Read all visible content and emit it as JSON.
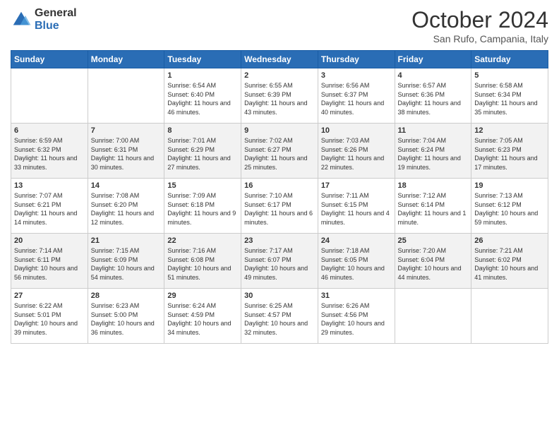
{
  "header": {
    "logo_general": "General",
    "logo_blue": "Blue",
    "title": "October 2024",
    "location": "San Rufo, Campania, Italy"
  },
  "weekdays": [
    "Sunday",
    "Monday",
    "Tuesday",
    "Wednesday",
    "Thursday",
    "Friday",
    "Saturday"
  ],
  "weeks": [
    [
      {
        "day": "",
        "sunrise": "",
        "sunset": "",
        "daylight": ""
      },
      {
        "day": "",
        "sunrise": "",
        "sunset": "",
        "daylight": ""
      },
      {
        "day": "1",
        "sunrise": "Sunrise: 6:54 AM",
        "sunset": "Sunset: 6:40 PM",
        "daylight": "Daylight: 11 hours and 46 minutes."
      },
      {
        "day": "2",
        "sunrise": "Sunrise: 6:55 AM",
        "sunset": "Sunset: 6:39 PM",
        "daylight": "Daylight: 11 hours and 43 minutes."
      },
      {
        "day": "3",
        "sunrise": "Sunrise: 6:56 AM",
        "sunset": "Sunset: 6:37 PM",
        "daylight": "Daylight: 11 hours and 40 minutes."
      },
      {
        "day": "4",
        "sunrise": "Sunrise: 6:57 AM",
        "sunset": "Sunset: 6:36 PM",
        "daylight": "Daylight: 11 hours and 38 minutes."
      },
      {
        "day": "5",
        "sunrise": "Sunrise: 6:58 AM",
        "sunset": "Sunset: 6:34 PM",
        "daylight": "Daylight: 11 hours and 35 minutes."
      }
    ],
    [
      {
        "day": "6",
        "sunrise": "Sunrise: 6:59 AM",
        "sunset": "Sunset: 6:32 PM",
        "daylight": "Daylight: 11 hours and 33 minutes."
      },
      {
        "day": "7",
        "sunrise": "Sunrise: 7:00 AM",
        "sunset": "Sunset: 6:31 PM",
        "daylight": "Daylight: 11 hours and 30 minutes."
      },
      {
        "day": "8",
        "sunrise": "Sunrise: 7:01 AM",
        "sunset": "Sunset: 6:29 PM",
        "daylight": "Daylight: 11 hours and 27 minutes."
      },
      {
        "day": "9",
        "sunrise": "Sunrise: 7:02 AM",
        "sunset": "Sunset: 6:27 PM",
        "daylight": "Daylight: 11 hours and 25 minutes."
      },
      {
        "day": "10",
        "sunrise": "Sunrise: 7:03 AM",
        "sunset": "Sunset: 6:26 PM",
        "daylight": "Daylight: 11 hours and 22 minutes."
      },
      {
        "day": "11",
        "sunrise": "Sunrise: 7:04 AM",
        "sunset": "Sunset: 6:24 PM",
        "daylight": "Daylight: 11 hours and 19 minutes."
      },
      {
        "day": "12",
        "sunrise": "Sunrise: 7:05 AM",
        "sunset": "Sunset: 6:23 PM",
        "daylight": "Daylight: 11 hours and 17 minutes."
      }
    ],
    [
      {
        "day": "13",
        "sunrise": "Sunrise: 7:07 AM",
        "sunset": "Sunset: 6:21 PM",
        "daylight": "Daylight: 11 hours and 14 minutes."
      },
      {
        "day": "14",
        "sunrise": "Sunrise: 7:08 AM",
        "sunset": "Sunset: 6:20 PM",
        "daylight": "Daylight: 11 hours and 12 minutes."
      },
      {
        "day": "15",
        "sunrise": "Sunrise: 7:09 AM",
        "sunset": "Sunset: 6:18 PM",
        "daylight": "Daylight: 11 hours and 9 minutes."
      },
      {
        "day": "16",
        "sunrise": "Sunrise: 7:10 AM",
        "sunset": "Sunset: 6:17 PM",
        "daylight": "Daylight: 11 hours and 6 minutes."
      },
      {
        "day": "17",
        "sunrise": "Sunrise: 7:11 AM",
        "sunset": "Sunset: 6:15 PM",
        "daylight": "Daylight: 11 hours and 4 minutes."
      },
      {
        "day": "18",
        "sunrise": "Sunrise: 7:12 AM",
        "sunset": "Sunset: 6:14 PM",
        "daylight": "Daylight: 11 hours and 1 minute."
      },
      {
        "day": "19",
        "sunrise": "Sunrise: 7:13 AM",
        "sunset": "Sunset: 6:12 PM",
        "daylight": "Daylight: 10 hours and 59 minutes."
      }
    ],
    [
      {
        "day": "20",
        "sunrise": "Sunrise: 7:14 AM",
        "sunset": "Sunset: 6:11 PM",
        "daylight": "Daylight: 10 hours and 56 minutes."
      },
      {
        "day": "21",
        "sunrise": "Sunrise: 7:15 AM",
        "sunset": "Sunset: 6:09 PM",
        "daylight": "Daylight: 10 hours and 54 minutes."
      },
      {
        "day": "22",
        "sunrise": "Sunrise: 7:16 AM",
        "sunset": "Sunset: 6:08 PM",
        "daylight": "Daylight: 10 hours and 51 minutes."
      },
      {
        "day": "23",
        "sunrise": "Sunrise: 7:17 AM",
        "sunset": "Sunset: 6:07 PM",
        "daylight": "Daylight: 10 hours and 49 minutes."
      },
      {
        "day": "24",
        "sunrise": "Sunrise: 7:18 AM",
        "sunset": "Sunset: 6:05 PM",
        "daylight": "Daylight: 10 hours and 46 minutes."
      },
      {
        "day": "25",
        "sunrise": "Sunrise: 7:20 AM",
        "sunset": "Sunset: 6:04 PM",
        "daylight": "Daylight: 10 hours and 44 minutes."
      },
      {
        "day": "26",
        "sunrise": "Sunrise: 7:21 AM",
        "sunset": "Sunset: 6:02 PM",
        "daylight": "Daylight: 10 hours and 41 minutes."
      }
    ],
    [
      {
        "day": "27",
        "sunrise": "Sunrise: 6:22 AM",
        "sunset": "Sunset: 5:01 PM",
        "daylight": "Daylight: 10 hours and 39 minutes."
      },
      {
        "day": "28",
        "sunrise": "Sunrise: 6:23 AM",
        "sunset": "Sunset: 5:00 PM",
        "daylight": "Daylight: 10 hours and 36 minutes."
      },
      {
        "day": "29",
        "sunrise": "Sunrise: 6:24 AM",
        "sunset": "Sunset: 4:59 PM",
        "daylight": "Daylight: 10 hours and 34 minutes."
      },
      {
        "day": "30",
        "sunrise": "Sunrise: 6:25 AM",
        "sunset": "Sunset: 4:57 PM",
        "daylight": "Daylight: 10 hours and 32 minutes."
      },
      {
        "day": "31",
        "sunrise": "Sunrise: 6:26 AM",
        "sunset": "Sunset: 4:56 PM",
        "daylight": "Daylight: 10 hours and 29 minutes."
      },
      {
        "day": "",
        "sunrise": "",
        "sunset": "",
        "daylight": ""
      },
      {
        "day": "",
        "sunrise": "",
        "sunset": "",
        "daylight": ""
      }
    ]
  ]
}
